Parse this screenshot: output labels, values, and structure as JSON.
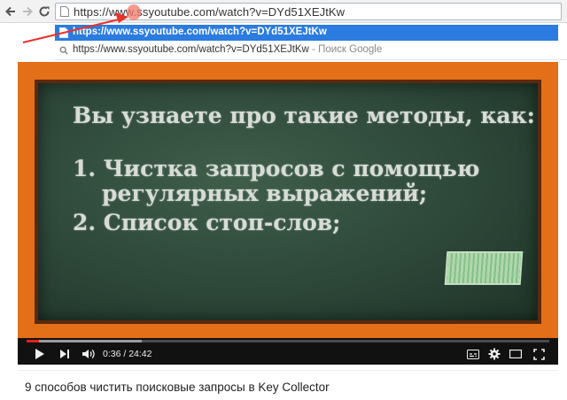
{
  "browser": {
    "url": "https://www.ssyoutube.com/watch?v=DYd51XEJtKw"
  },
  "dropdown": {
    "items": [
      {
        "text": "https://www.ssyoutube.com/watch?v=DYd51XEJtKw"
      },
      {
        "text": "https://www.ssyoutube.com/watch?v=DYd51XEJtKw",
        "separator": " - ",
        "hint": "Поиск Google"
      }
    ]
  },
  "slide": {
    "lines": [
      "Вы узнаете про такие методы, как:",
      "1. Чистка запросов с помощью",
      "регулярных выражений;",
      "2. Список стоп-слов;"
    ]
  },
  "player": {
    "time_display": "0:36 / 24:42",
    "progress_fraction": 0.024,
    "buffer_fraction": 0.22,
    "accent_color": "#e62117"
  },
  "video": {
    "title": "9 способов чистить поисковые запросы в Key Collector"
  }
}
